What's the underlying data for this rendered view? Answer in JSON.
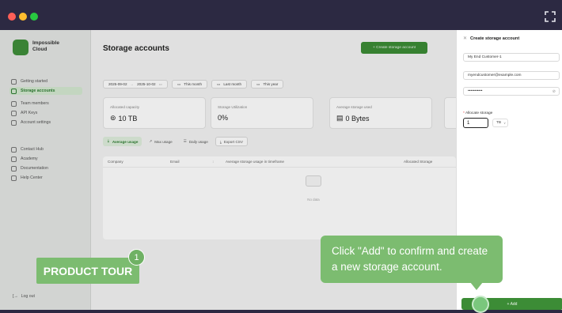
{
  "app": {
    "logo_line1": "Impossible",
    "logo_line2": "Cloud"
  },
  "sidebar": {
    "items": [
      {
        "label": "Getting started",
        "icon": "rocket-icon"
      },
      {
        "label": "Storage accounts",
        "icon": "users-icon",
        "active": true
      },
      {
        "label": "Team members",
        "icon": "person-plus-icon"
      },
      {
        "label": "API Keys",
        "icon": "key-icon"
      },
      {
        "label": "Account settings",
        "icon": "gear-icon"
      },
      {
        "label": "Contact Hub",
        "icon": "contact-icon"
      },
      {
        "label": "Academy",
        "icon": "graduation-icon"
      },
      {
        "label": "Documentation",
        "icon": "book-icon"
      },
      {
        "label": "Help Center",
        "icon": "help-icon"
      }
    ],
    "logout": "Log out"
  },
  "main": {
    "title": "Storage accounts",
    "create_button": "+ Create storage account",
    "date_from": "2025-09-02",
    "date_to": "2025-10-02",
    "range_buttons": [
      "This month",
      "Last month",
      "This year"
    ],
    "stats": [
      {
        "label": "Allocated capacity",
        "value": "10 TB"
      },
      {
        "label": "Storage Utilization",
        "value": "0%"
      },
      {
        "label": "Average storage used",
        "value": "0 Bytes"
      }
    ],
    "tabs": [
      "Average usage",
      "Max usage",
      "Daily usage",
      "Export CSV"
    ],
    "columns": [
      "Company",
      "Email",
      "Average storage usage in timeframe",
      "Allocated Storage"
    ],
    "empty_text": "No data"
  },
  "drawer": {
    "title": "Create storage account",
    "fields": {
      "name": "My End Customer-1",
      "email": "myendcustomer@example.com",
      "password": "•••••••••••"
    },
    "allocate_label": "Allocate storage",
    "allocate_value": "1",
    "unit": "TB",
    "add_button": "+ Add"
  },
  "tour": {
    "tooltip": "Click \"Add\" to confirm and create a new storage account.",
    "button": "PRODUCT TOUR",
    "step": "1"
  },
  "colors": {
    "accent": "#3c8c36",
    "tour_green": "#7cbc70",
    "bg": "#2c2942"
  }
}
